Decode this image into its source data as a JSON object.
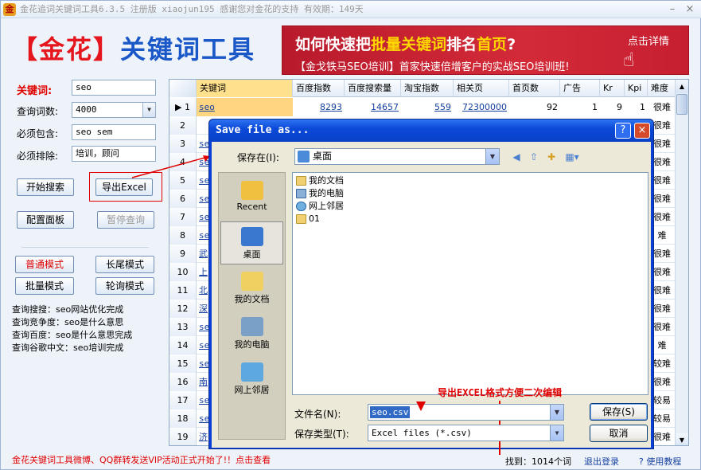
{
  "window": {
    "title": "金花追词关键词工具6.3.5  注册版  xiaojun195  感谢您对金花的支持  有效期：149天",
    "minimize": "–",
    "close": "×"
  },
  "brand": {
    "prefix": "【",
    "name": "金花",
    "suffix": "】",
    "product": "关键词工具"
  },
  "banner": {
    "line1_pre": "如何快速把",
    "line1_hl": "批量关键词",
    "line1_mid": "排名",
    "line1_hl2": "首页",
    "line1_post": "?",
    "line2": "【金戈铁马SEO培训】首家快速倍增客户的实战SEO培训班!",
    "detail": "点击详情"
  },
  "form": {
    "keyword_label": "关键词:",
    "keyword_value": "seo",
    "count_label": "查询词数:",
    "count_value": "4000",
    "include_label": "必须包含:",
    "include_value": "seo sem",
    "exclude_label": "必须排除:",
    "exclude_value": "培训，顾问"
  },
  "buttons": {
    "start": "开始搜索",
    "export": "导出Excel",
    "config": "配置面板",
    "pause": "暂停查询",
    "normal_mode": "普通模式",
    "longtail_mode": "长尾模式",
    "batch_mode": "批量模式",
    "poll_mode": "轮询模式"
  },
  "log": [
    "查询搜搜：seo网站优化完成",
    "查询竞争度：seo是什么意思",
    "查询百度：seo是什么意思完成",
    "查询谷歌中文：seo培训完成"
  ],
  "table": {
    "headers": [
      "关键词",
      "百度指数",
      "百度搜索量",
      "淘宝指数",
      "相关页",
      "首页数",
      "广告",
      "Kr",
      "Kpi",
      "难度"
    ],
    "first_row": {
      "num": "1",
      "keyword": "seo",
      "baidu_index": "8293",
      "baidu_search": "14657",
      "taobao": "559",
      "related": "72300000",
      "home": "92",
      "ads": "1",
      "kr": "9",
      "kpi": "1",
      "difficulty": "很难"
    },
    "rows": [
      {
        "num": "2",
        "kw": "",
        "diff": "很难"
      },
      {
        "num": "3",
        "kw": "se",
        "diff": "很难"
      },
      {
        "num": "4",
        "kw": "se",
        "diff": "很难"
      },
      {
        "num": "5",
        "kw": "se",
        "diff": "很难"
      },
      {
        "num": "6",
        "kw": "se",
        "diff": "很难"
      },
      {
        "num": "7",
        "kw": "se",
        "diff": "很难"
      },
      {
        "num": "8",
        "kw": "se",
        "diff": "难"
      },
      {
        "num": "9",
        "kw": "武",
        "diff": "很难"
      },
      {
        "num": "10",
        "kw": "上",
        "diff": "很难"
      },
      {
        "num": "11",
        "kw": "北",
        "diff": "很难"
      },
      {
        "num": "12",
        "kw": "深",
        "diff": "很难"
      },
      {
        "num": "13",
        "kw": "se",
        "diff": "很难"
      },
      {
        "num": "14",
        "kw": "se",
        "diff": "难"
      },
      {
        "num": "15",
        "kw": "se",
        "diff": "较难"
      },
      {
        "num": "16",
        "kw": "南",
        "diff": "很难"
      },
      {
        "num": "17",
        "kw": "se",
        "diff": "较易"
      },
      {
        "num": "18",
        "kw": "se",
        "diff": "较易"
      },
      {
        "num": "19",
        "kw": "济",
        "diff": "很难"
      }
    ]
  },
  "dialog": {
    "title": "Save file as...",
    "help": "?",
    "close": "×",
    "save_in_label": "保存在(I):",
    "save_in_value": "桌面",
    "places": [
      "Recent",
      "桌面",
      "我的文档",
      "我的电脑",
      "网上邻居"
    ],
    "files": [
      "我的文档",
      "我的电脑",
      "网上邻居",
      "01"
    ],
    "annotation": "导出EXCEL格式方便二次编辑",
    "filename_label": "文件名(N):",
    "filename_value": "seo.csv",
    "filetype_label": "保存类型(T):",
    "filetype_value": "Excel files (*.csv)",
    "save": "保存(S)",
    "cancel": "取消"
  },
  "status": {
    "promo": "金花关键词工具微博、QQ群转发送VIP活动正式开始了!！点击查看",
    "found": "找到：1014个词",
    "logout": "退出登录",
    "help": "? 使用教程"
  }
}
